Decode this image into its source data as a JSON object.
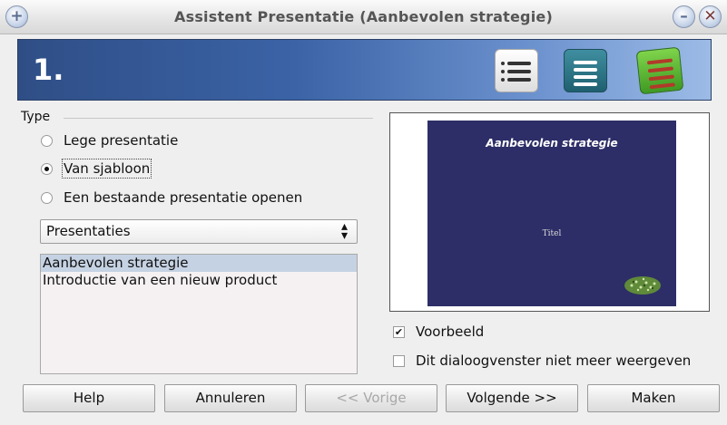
{
  "window": {
    "title": "Assistent Presentatie (Aanbevolen strategie)",
    "add_glyph": "+",
    "minimize_glyph": "–",
    "close_glyph": "✕"
  },
  "banner": {
    "step": "1."
  },
  "type_group": {
    "label": "Type",
    "options": [
      {
        "label": "Lege presentatie",
        "checked": false
      },
      {
        "label": "Van sjabloon",
        "checked": true
      },
      {
        "label": "Een bestaande presentatie openen",
        "checked": false
      }
    ]
  },
  "template_category": {
    "selected": "Presentaties"
  },
  "templates": [
    {
      "label": "Aanbevolen strategie",
      "selected": true
    },
    {
      "label": "Introductie van een nieuw product",
      "selected": false
    }
  ],
  "preview": {
    "slide_title": "Aanbevolen strategie",
    "slide_subtitle": "Titel"
  },
  "options": {
    "preview_label": "Voorbeeld",
    "preview_checked": true,
    "dont_show_label": "Dit dialoogvenster niet meer weergeven",
    "dont_show_checked": false
  },
  "buttons": {
    "help": "Help",
    "cancel": "Annuleren",
    "back": "<< Vorige",
    "next": "Volgende >>",
    "create": "Maken"
  },
  "colors": {
    "slide_background": "#2d2e67",
    "banner_accent": "#3b63a6",
    "selection": "#c5d2e3"
  }
}
